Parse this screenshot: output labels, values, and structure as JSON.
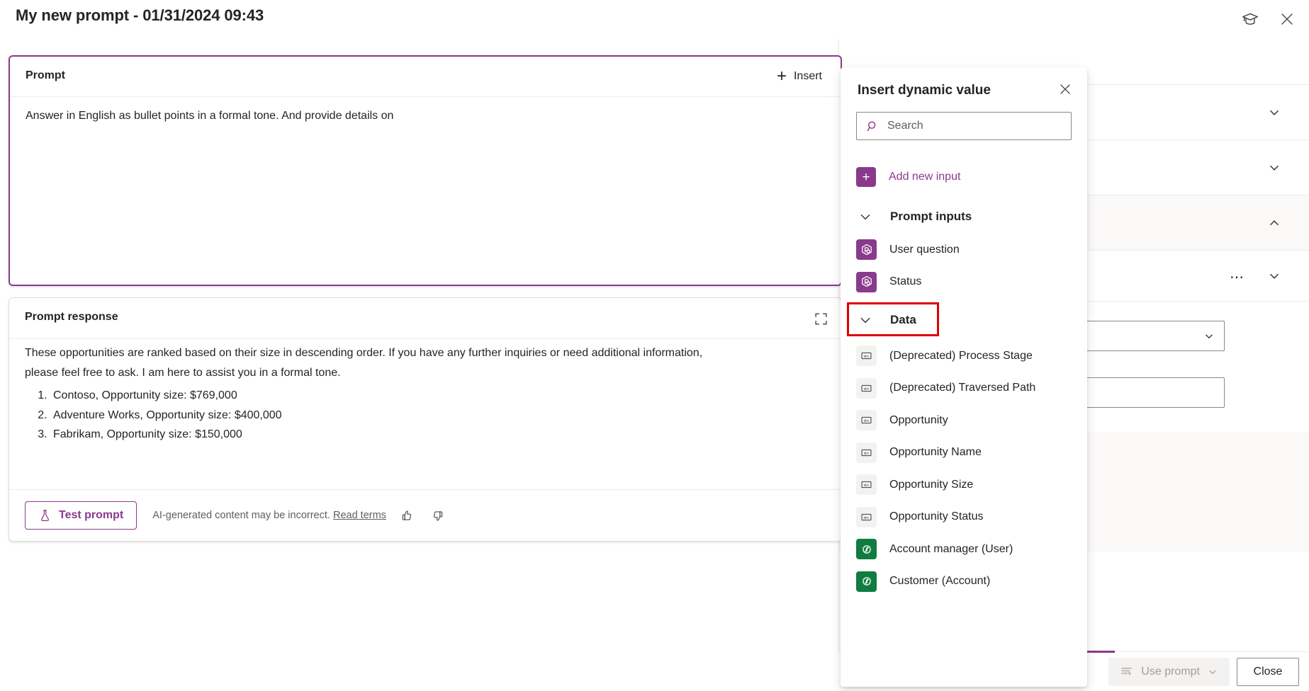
{
  "titlebar": {
    "title": "My new prompt - 01/31/2024 09:43",
    "learn_icon": "graduation-cap-icon",
    "close_icon": "close-icon"
  },
  "prompt_card": {
    "label": "Prompt",
    "insert_label": "Insert",
    "insert_icon": "plus-icon",
    "text": "Answer in English as bullet points in a formal tone. And provide details on"
  },
  "response_card": {
    "label": "Prompt response",
    "expand_icon": "expand-icon",
    "paragraph": "These opportunities are ranked based on their size in descending order. If you have any further inquiries or need additional information, please feel free to ask. I am here to assist you in a formal tone.",
    "items": [
      "Contoso, Opportunity size: $769,000",
      "Adventure Works, Opportunity size: $400,000",
      "Fabrikam, Opportunity size: $150,000"
    ],
    "test_button": "Test prompt",
    "test_icon": "flask-icon",
    "disclaimer": "AI-generated content may be incorrect.",
    "read_terms": "Read terms",
    "thumbs_up_icon": "thumbs-up-icon",
    "thumbs_down_icon": "thumbs-down-icon"
  },
  "flyout": {
    "title": "Insert dynamic value",
    "close_icon": "close-icon",
    "search": {
      "placeholder": "Search",
      "value": "",
      "icon": "search-icon"
    },
    "add_new_input": {
      "label": "Add new input",
      "icon": "plus-icon"
    },
    "groups": [
      {
        "label": "Prompt inputs",
        "expanded": true,
        "chevron": "chevron-down-icon",
        "highlighted": false,
        "items": [
          {
            "label": "User question",
            "icon": "copilot-input-icon",
            "kind": "purple"
          },
          {
            "label": "Status",
            "icon": "copilot-input-icon",
            "kind": "purple"
          }
        ]
      },
      {
        "label": "Data",
        "expanded": true,
        "chevron": "chevron-down-icon",
        "highlighted": true,
        "items": [
          {
            "label": "(Deprecated) Process Stage",
            "icon": "text-field-icon",
            "kind": "abc"
          },
          {
            "label": "(Deprecated) Traversed Path",
            "icon": "text-field-icon",
            "kind": "abc"
          },
          {
            "label": "Opportunity",
            "icon": "text-field-icon",
            "kind": "abc"
          },
          {
            "label": "Opportunity Name",
            "icon": "text-field-icon",
            "kind": "abc"
          },
          {
            "label": "Opportunity Size",
            "icon": "text-field-icon",
            "kind": "abc"
          },
          {
            "label": "Opportunity Status",
            "icon": "text-field-icon",
            "kind": "abc"
          },
          {
            "label": "Account manager (User)",
            "icon": "dataverse-lookup-icon",
            "kind": "green"
          },
          {
            "label": "Customer (Account)",
            "icon": "dataverse-lookup-icon",
            "kind": "green"
          }
        ]
      }
    ]
  },
  "background_panel": {
    "sections": [
      {
        "chevron": "chevron-down-icon",
        "shaded": false
      },
      {
        "chevron": "chevron-down-icon",
        "shaded": false
      },
      {
        "chevron": "chevron-up-icon",
        "shaded": true
      }
    ],
    "overflow_icon": "more-options-icon",
    "row_chevron": "chevron-down-icon",
    "combobox_chevron": "chevron-down-icon"
  },
  "bottombar": {
    "use_prompt_label": "Use prompt",
    "use_prompt_icon": "insert-prompt-icon",
    "use_prompt_chevron": "chevron-down-icon",
    "close_label": "Close"
  },
  "colors": {
    "accent_purple": "#8a3a8a",
    "highlight_red": "#e00000",
    "dataverse_green": "#107c41",
    "text_primary": "#242424",
    "text_secondary": "#605e5c"
  }
}
